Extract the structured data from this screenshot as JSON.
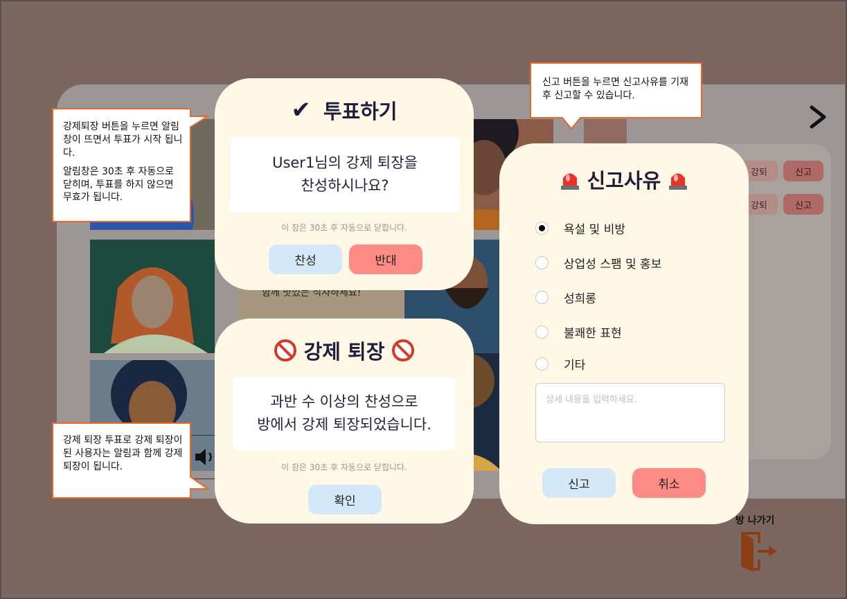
{
  "vote_modal": {
    "title": "투표하기",
    "check_glyph": "✔",
    "question_line1": "User1님의 강제 퇴장을",
    "question_line2": "찬성하시나요?",
    "notice": "이 창은 30초 후 자동으로 닫힙니다.",
    "agree_label": "찬성",
    "disagree_label": "반대"
  },
  "kick_modal": {
    "title": "강제 퇴장",
    "message_line1": "과반 수 이상의 찬성으로",
    "message_line2": "방에서 강제 퇴장되었습니다.",
    "notice": "이 창은 30초 후 자동으로 닫힙니다.",
    "confirm_label": "확인"
  },
  "report_modal": {
    "title": "신고사유",
    "options": [
      {
        "label": "욕설 및 비방",
        "selected": true
      },
      {
        "label": "상업성 스팸 및 홍보",
        "selected": false
      },
      {
        "label": "성희롱",
        "selected": false
      },
      {
        "label": "불쾌한 표현",
        "selected": false
      },
      {
        "label": "기타",
        "selected": false
      }
    ],
    "detail_placeholder": "상세 내용을 입력하세요.",
    "submit_label": "신고",
    "cancel_label": "취소"
  },
  "background": {
    "kick_button_label": "강퇴",
    "report_button_label": "신고",
    "image_caption": "함께 맛있는 식사하세요!",
    "exit_label": "방 나가기"
  },
  "annotations": {
    "vote_note_p1": "강제퇴장 버튼을 누르면 알림 창이 뜨면서 투표가 시작 됩니다.",
    "vote_note_p2": "알림창은 30초 후 자동으로 닫히며, 투표를 하지 않으면 무효가 됩니다.",
    "kick_note": "강제 퇴장 투표로 강제 퇴장이 된 사용자는 알림과 함께 강제퇴장이 됩니다.",
    "report_note": "신고 버튼을 누르면 신고사유를 기재 후 신고할 수 있습니다."
  },
  "colors": {
    "overlay": "#7b675f",
    "card": "#fff8e6",
    "accent_blue": "#d4e8f7",
    "accent_red": "#ff8b87",
    "callout_border": "#e16a2c",
    "exit_icon": "#8a3f14"
  },
  "icons": {
    "vote_title": "check-icon",
    "kick_title": "no-entry-icon",
    "report_title": "siren-icon",
    "exit": "exit-door-icon",
    "next": "chevron-right-icon",
    "speaker": "speaker-icon"
  }
}
